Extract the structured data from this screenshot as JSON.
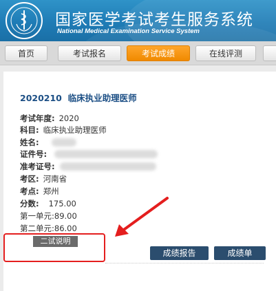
{
  "header": {
    "logo_text": "国家医学考试中心",
    "title": "国家医学考试考生服务系统",
    "subtitle": "National Medical Examination Service System"
  },
  "nav": {
    "tabs": [
      {
        "label": "首页",
        "active": false
      },
      {
        "label": "考试报名",
        "active": false
      },
      {
        "label": "考试成绩",
        "active": true
      },
      {
        "label": "在线评测",
        "active": false
      }
    ]
  },
  "result": {
    "exam_code": "2020210",
    "exam_name": "临床执业助理医师",
    "fields": [
      {
        "label": "考试年度:",
        "value": "2020"
      },
      {
        "label": "科目:",
        "value": "临床执业助理医师"
      },
      {
        "label": "姓名:",
        "value": ""
      },
      {
        "label": "证件号:",
        "value": ""
      },
      {
        "label": "准考证号:",
        "value": ""
      },
      {
        "label": "考区:",
        "value": "河南省"
      },
      {
        "label": "考点:",
        "value": "郑州"
      },
      {
        "label": "分数:",
        "value": "175.00"
      }
    ],
    "units": [
      {
        "label": "第一单元:",
        "value": "89.00"
      },
      {
        "label": "第二单元:",
        "value": "86.00"
      }
    ],
    "note_badge": "二试说明",
    "buttons": {
      "report": "成绩报告",
      "sheet": "成绩单"
    }
  },
  "colors": {
    "header_blue": "#1f7cb6",
    "active_tab": "#f08a00",
    "button_navy": "#2b4d6e",
    "annotation_red": "#e41e1e"
  }
}
